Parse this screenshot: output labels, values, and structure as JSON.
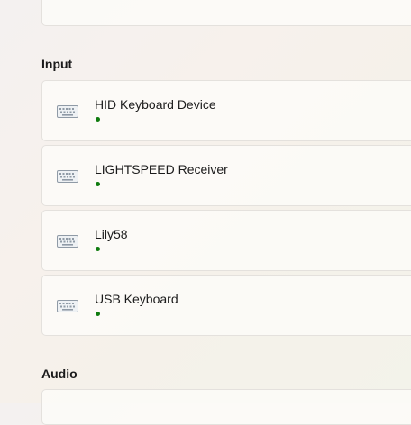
{
  "sections": {
    "input": "Input",
    "audio": "Audio"
  },
  "devices": [
    {
      "name": "HID Keyboard Device",
      "icon": "keyboard-icon",
      "status": "connected"
    },
    {
      "name": "LIGHTSPEED Receiver",
      "icon": "keyboard-icon",
      "status": "connected"
    },
    {
      "name": "Lily58",
      "icon": "keyboard-icon",
      "status": "connected"
    },
    {
      "name": "USB Keyboard",
      "icon": "keyboard-icon",
      "status": "connected"
    }
  ],
  "colors": {
    "status_connected": "#0f7b0f",
    "icon": "#8f9aa6"
  }
}
